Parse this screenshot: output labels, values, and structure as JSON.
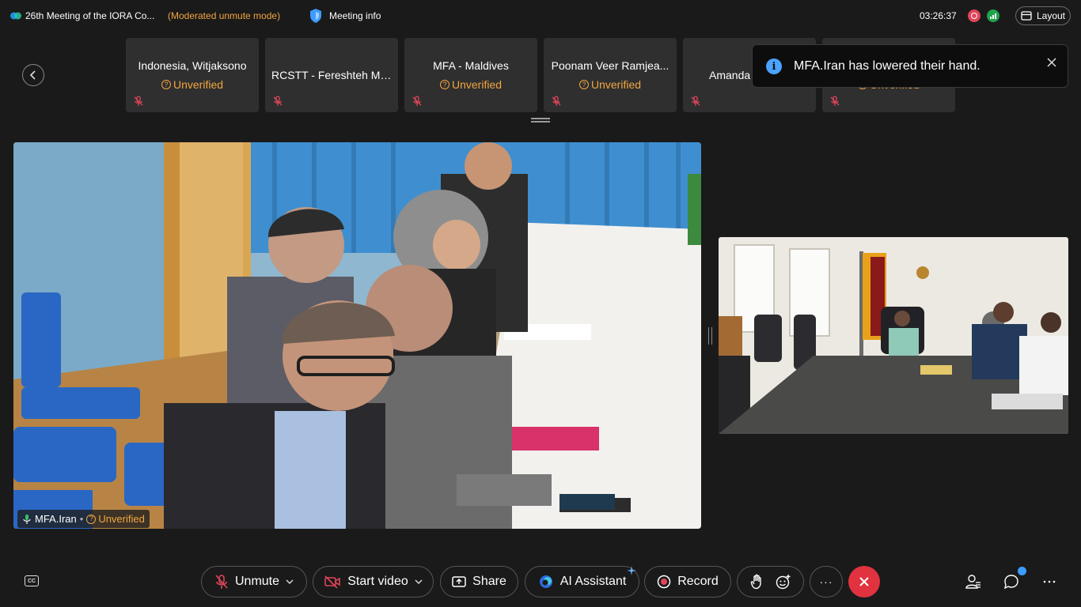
{
  "topbar": {
    "meeting_title": "26th Meeting of the IORA Co...",
    "mode": "(Moderated unmute mode)",
    "meeting_info_label": "Meeting info",
    "clock": "03:26:37",
    "layout_label": "Layout"
  },
  "participants": [
    {
      "name": "Indonesia, Witjaksono",
      "status": "Unverified"
    },
    {
      "name": "RCSTT - Fereshteh Mo...",
      "status": ""
    },
    {
      "name": "MFA - Maldives",
      "status": "Unverified"
    },
    {
      "name": "Poonam Veer Ramjea...",
      "status": "Unverified"
    },
    {
      "name": "Amanda",
      "status": ""
    },
    {
      "name": "",
      "status": "Unverified"
    }
  ],
  "toast": {
    "message": "MFA.Iran has lowered their hand."
  },
  "main_video": {
    "participant_name": "MFA.Iran",
    "separator": "•",
    "status": "Unverified"
  },
  "toolbar": {
    "unmute_label": "Unmute",
    "start_video_label": "Start video",
    "share_label": "Share",
    "ai_assistant_label": "AI Assistant",
    "record_label": "Record",
    "cc_label": "CC",
    "more_label": "···"
  },
  "icons": {
    "app_logo": "webex-logo-icon",
    "meeting_info": "shield-icon",
    "mic_muted": "mic-off-icon",
    "video_off": "video-off-icon",
    "share": "share-screen-icon",
    "ai": "ai-assistant-icon",
    "record": "record-icon",
    "raise_hand": "raise-hand-icon",
    "reactions": "emoji-icon",
    "end": "close-icon",
    "participants": "participants-icon",
    "chat": "chat-icon"
  },
  "colors": {
    "background": "#1a1a1a",
    "tile": "#2f2f2f",
    "warning": "#f2a640",
    "end_call": "#e0323f",
    "accent": "#3e9bff"
  }
}
